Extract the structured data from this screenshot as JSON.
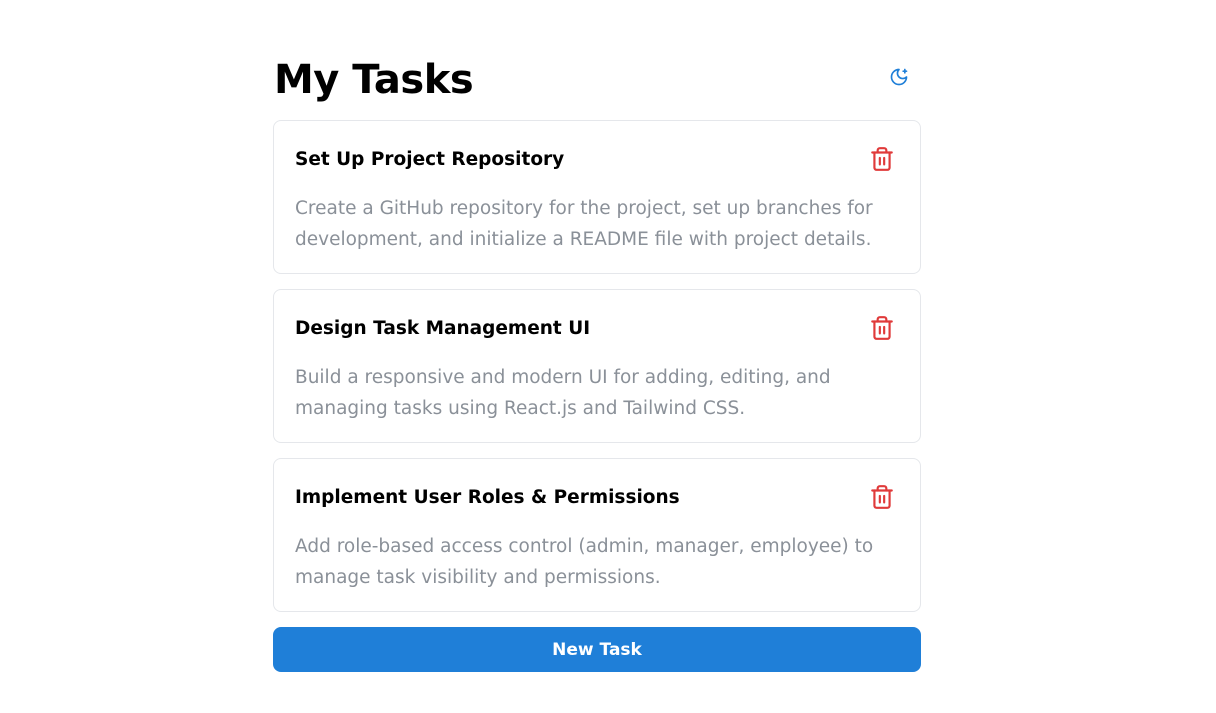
{
  "header": {
    "title": "My Tasks",
    "theme_toggle_icon": "moon-icon"
  },
  "tasks": [
    {
      "title": "Set Up Project Repository",
      "description": "Create a GitHub repository for the project, set up branches for development, and initialize a README file with project details.",
      "delete_icon": "trash-icon"
    },
    {
      "title": "Design Task Management UI",
      "description": "Build a responsive and modern UI for adding, editing, and managing tasks using React.js and Tailwind CSS.",
      "delete_icon": "trash-icon"
    },
    {
      "title": "Implement User Roles & Permissions",
      "description": "Add role-based access control (admin, manager, employee) to manage task visibility and permissions.",
      "delete_icon": "trash-icon"
    }
  ],
  "new_task_button": {
    "label": "New Task"
  },
  "colors": {
    "accent": "#1f7fd8",
    "delete": "#e03a3a",
    "description_text": "#8a9098",
    "card_border": "#e5e7eb"
  }
}
